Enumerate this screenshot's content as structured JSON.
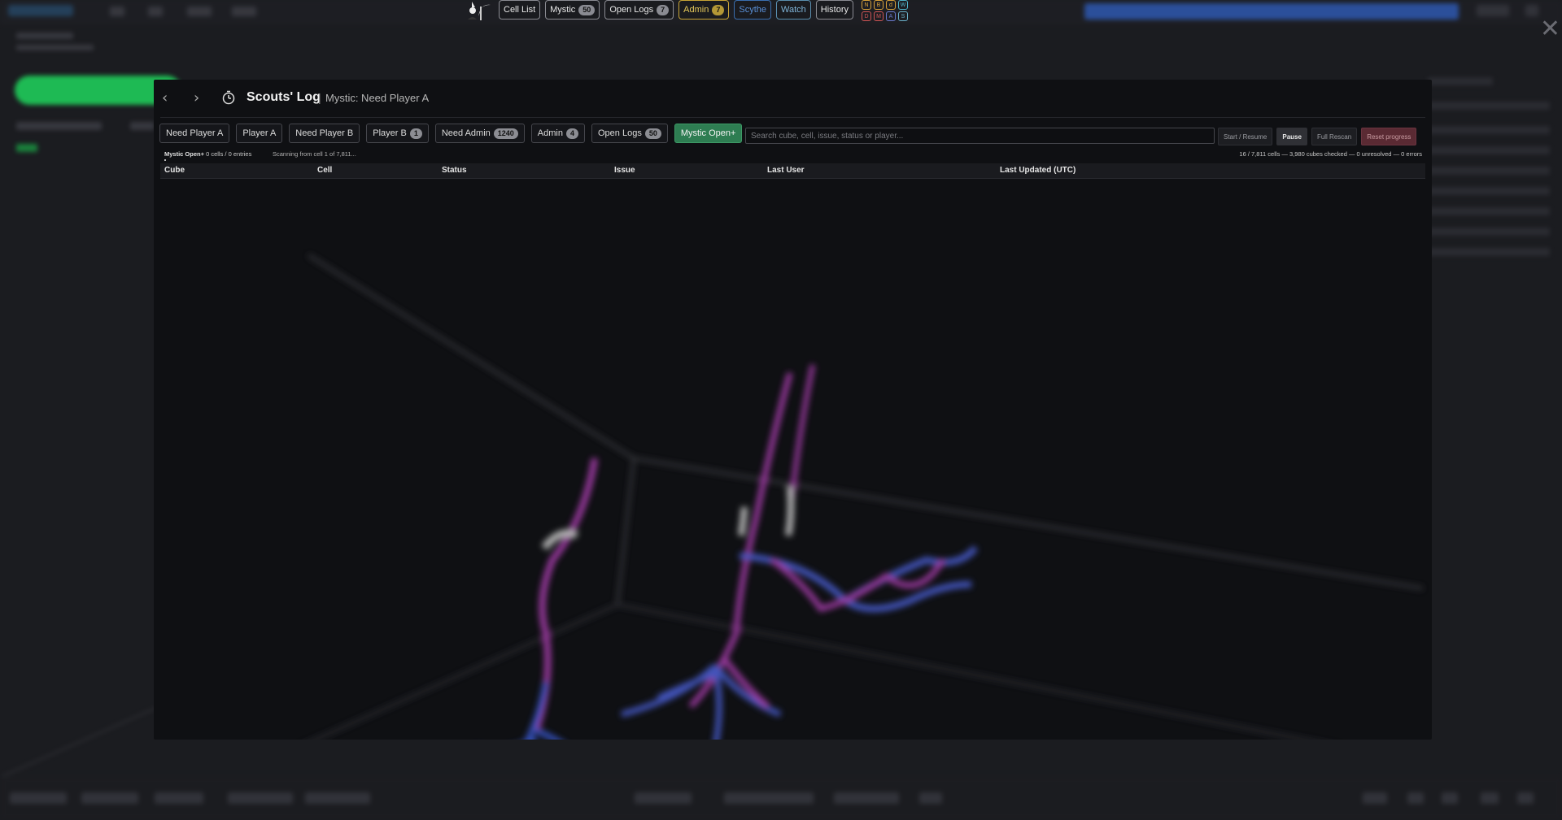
{
  "toolbar": {
    "cell_list": "Cell List",
    "mystic": {
      "label": "Mystic",
      "count": "50"
    },
    "open_logs": {
      "label": "Open Logs",
      "count": "7"
    },
    "admin": {
      "label": "Admin",
      "count": "7"
    },
    "scythe": "Scythe",
    "watch": "Watch",
    "history": "History",
    "grid_top": [
      "N",
      "B",
      "d",
      "W"
    ],
    "grid_bottom": [
      "D",
      "M",
      "A",
      "S"
    ]
  },
  "modal": {
    "title": "Scouts' Log",
    "separator": "|",
    "subtitle": "Mystic: Need Player A",
    "filters": [
      {
        "label": "Need Player A",
        "count": null
      },
      {
        "label": "Player A",
        "count": null
      },
      {
        "label": "Need Player B",
        "count": null
      },
      {
        "label": "Player B",
        "count": "1"
      },
      {
        "label": "Need Admin",
        "count": "1240"
      },
      {
        "label": "Admin",
        "count": "4"
      },
      {
        "label": "Open Logs",
        "count": "50"
      },
      {
        "label": "Mystic Open+",
        "count": null
      }
    ],
    "search_placeholder": "Search cube, cell, issue, status or player...",
    "actions": {
      "start": "Start / Resume",
      "pause": "Pause",
      "full_rescan": "Full Rescan",
      "reset": "Reset progress"
    },
    "status_left_bold": "Mystic Open+",
    "status_left_rest": "0 cells / 0 entries",
    "scan_text": "Scanning from cell 1 of 7,811...",
    "status_right": "16 / 7,811 cells — 3,980 cubes checked — 0 unresolved — 0 errors",
    "columns": [
      "Cube",
      "Cell",
      "Status",
      "Issue",
      "Last User",
      "Last Updated (UTC)"
    ]
  },
  "colors": {
    "active_filter": "#2e7d52",
    "admin_accent": "#c9a536",
    "scythe_accent": "#3a6fb0",
    "reset_bg": "#5a2a33"
  }
}
